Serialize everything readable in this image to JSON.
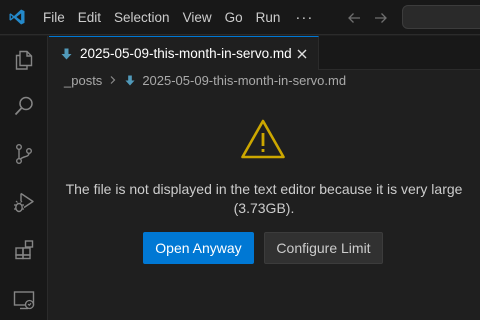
{
  "menu": {
    "items": [
      "File",
      "Edit",
      "Selection",
      "View",
      "Go",
      "Run"
    ],
    "more": "···"
  },
  "tab": {
    "title": "2025-05-09-this-month-in-servo.md",
    "icon": "markdown-arrow-icon"
  },
  "breadcrumb": {
    "folder": "_posts",
    "file": "2025-05-09-this-month-in-servo.md"
  },
  "editor": {
    "message": "The file is not displayed in the text editor because it is very large (3.73GB).",
    "open_anyway_label": "Open Anyway",
    "configure_limit_label": "Configure Limit"
  },
  "colors": {
    "accent": "#0078d4",
    "warning": "#cca700",
    "markdown_icon": "#519aba"
  }
}
